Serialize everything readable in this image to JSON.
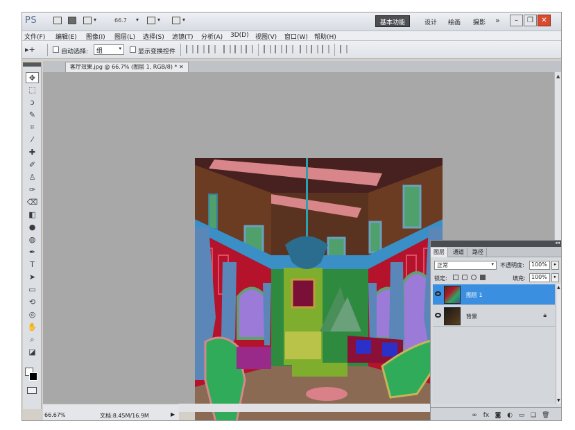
{
  "app": {
    "logo": "PS",
    "zoom": "66.7",
    "workspace_active": "基本功能",
    "workspace_items": [
      "设计",
      "绘画",
      "摄影"
    ],
    "more": "»"
  },
  "menu": [
    "文件(F)",
    "编辑(E)",
    "图像(I)",
    "图层(L)",
    "选择(S)",
    "滤镜(T)",
    "分析(A)",
    "3D(D)",
    "视图(V)",
    "窗口(W)",
    "帮助(H)"
  ],
  "options": {
    "tool_preset": "▸+",
    "auto_select_label": "自动选择:",
    "auto_select_value": "组",
    "show_controls_label": "显示变换控件"
  },
  "document": {
    "tab_title": "客厅效果.jpg @ 66.7% (图层 1, RGB/8) * ✕"
  },
  "status": {
    "zoom": "66.67%",
    "doc_info": "文档:8.45M/16.9M",
    "arrow": "▶"
  },
  "layers_panel": {
    "tabs": [
      "图层",
      "通道",
      "路径"
    ],
    "blend_mode": "正常",
    "opacity_label": "不透明度:",
    "opacity_value": "100%",
    "lock_label": "锁定:",
    "fill_label": "填充:",
    "fill_value": "100%",
    "layers": [
      {
        "name": "图层 1",
        "selected": true
      },
      {
        "name": "背景",
        "selected": false,
        "locked": true
      }
    ]
  },
  "colors": {
    "selection": "#3b8fe0",
    "canvas_bg": "#a8a8a8",
    "close_button": "#d94a2e"
  }
}
